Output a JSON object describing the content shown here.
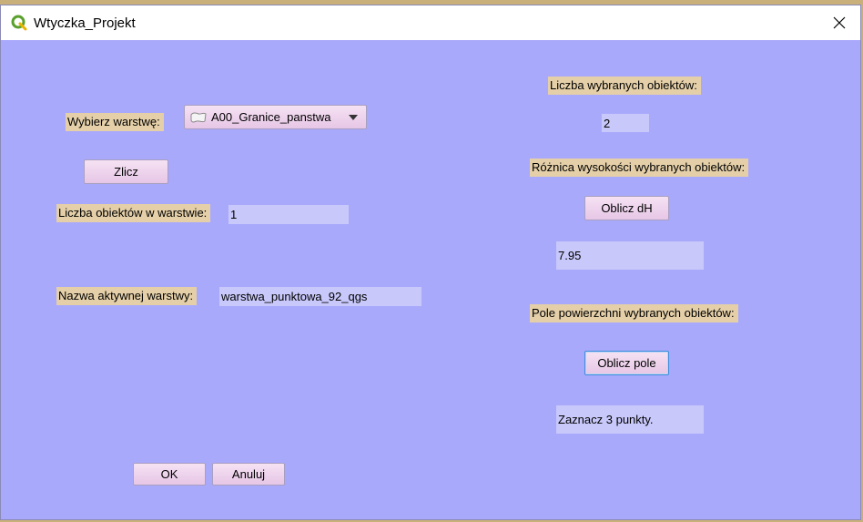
{
  "window": {
    "title": "Wtyczka_Projekt",
    "app_icon": "qgis-icon",
    "close_icon": "close-icon"
  },
  "left": {
    "layer_select_label": "Wybierz warstwę:",
    "layer_combo": {
      "value": "A00_Granice_panstwa",
      "icon": "polygon-layer-icon"
    },
    "count_button": "Zlicz",
    "object_count_label": "Liczba obiektów w warstwie:",
    "object_count_value": "1",
    "active_layer_label": "Nazwa aktywnej warstwy:",
    "active_layer_value": "warstwa_punktowa_92_qgs"
  },
  "right": {
    "selected_count_label": "Liczba wybranych obiektów:",
    "selected_count_value": "2",
    "height_diff_label": "Różnica wysokości wybranych obiektów:",
    "height_diff_button": "Oblicz dH",
    "height_diff_value": "7.95",
    "area_label": "Pole powierzchni wybranych obiektów:",
    "area_button": "Oblicz pole",
    "area_value": "Zaznacz 3 punkty."
  },
  "footer": {
    "ok_button": "OK",
    "cancel_button": "Anuluj"
  },
  "colors": {
    "dialog_background": "#a9a9fc",
    "label_background": "#e4cfa8",
    "field_background": "#c8c8fb",
    "button_background": "#f0d8ee"
  }
}
